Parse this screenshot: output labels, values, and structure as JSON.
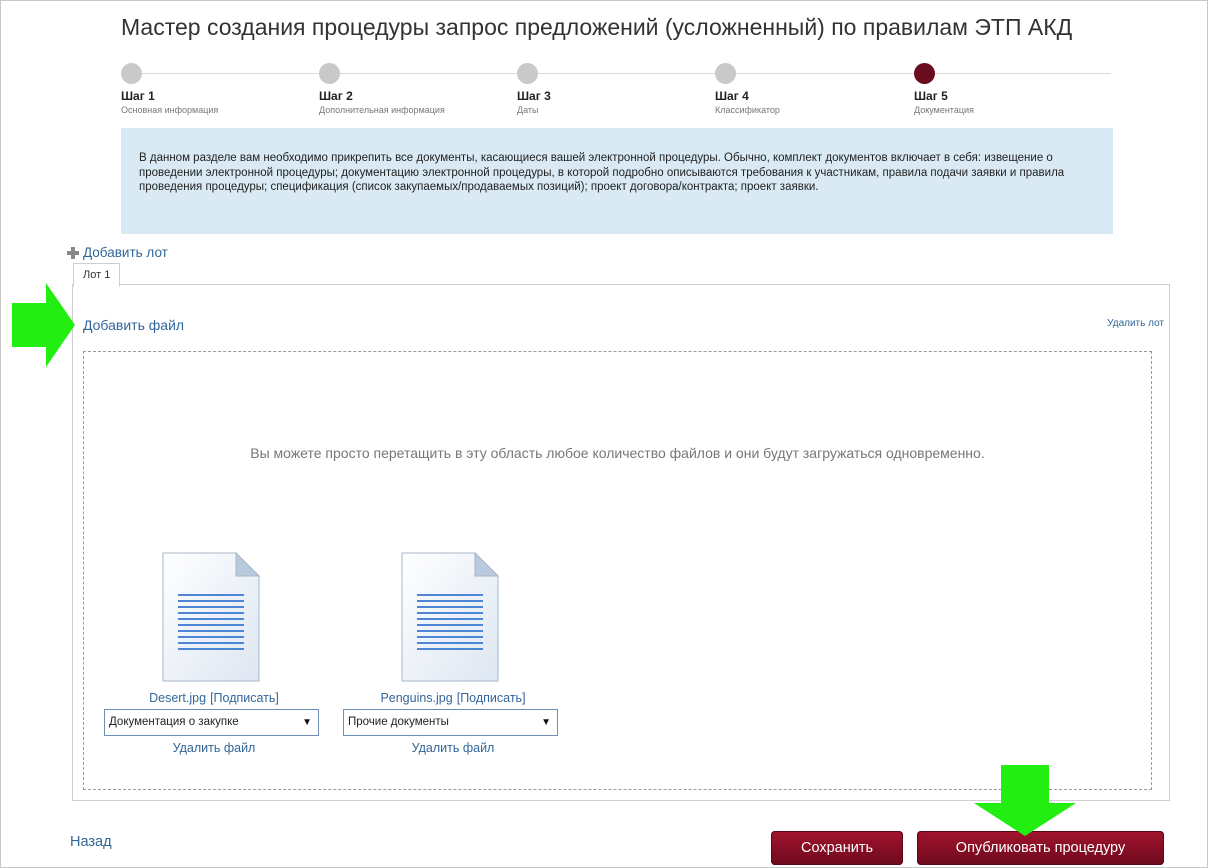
{
  "wizard": {
    "title": "Мастер создания процедуры запрос предложений (усложненный) по правилам ЭТП АКД",
    "steps": [
      {
        "label": "Шаг 1",
        "sub": "Основная информация",
        "state": "done"
      },
      {
        "label": "Шаг 2",
        "sub": "Дополнительная информация",
        "state": "done"
      },
      {
        "label": "Шаг 3",
        "sub": "Даты",
        "state": "done"
      },
      {
        "label": "Шаг 4",
        "sub": "Классификатор",
        "state": "done"
      },
      {
        "label": "Шаг 5",
        "sub": "Документация",
        "state": "active"
      }
    ],
    "info_text": "В данном разделе вам необходимо прикрепить все документы, касающиеся вашей электронной процедуры. Обычно, комплект документов включает в себя: извещение о проведении электронной процедуры; документацию электронной процедуры, в которой подробно описываются требования к участникам, правила подачи заявки и правила проведения процедуры; спецификация (список закупаемых/продаваемых позиций); проект договора/контракта; проект заявки."
  },
  "lots": {
    "add_lot_label": "Добавить лот",
    "tab_label": "Лот 1",
    "add_file_label": "Добавить файл",
    "delete_lot_label": "Удалить лот",
    "drop_hint": "Вы можете просто перетащить в эту область любое количество файлов и они будут загружаться одновременно.",
    "files": [
      {
        "name": "Desert.jpg",
        "sign_label": "[Подписать]",
        "doc_type": "Документация о закупке",
        "delete_label": "Удалить файл",
        "icon": "document-icon"
      },
      {
        "name": "Penguins.jpg",
        "sign_label": "[Подписать]",
        "doc_type": "Прочие документы",
        "delete_label": "Удалить файл",
        "icon": "document-icon"
      }
    ]
  },
  "footer": {
    "back_label": "Назад",
    "save_label": "Сохранить",
    "publish_label": "Опубликовать процедуру"
  },
  "colors": {
    "accent": "#6b0b1e",
    "link": "#336699",
    "info_bg": "#d9eaf5",
    "annotation_arrow": "#22ee11"
  },
  "select_arrow": "▼"
}
